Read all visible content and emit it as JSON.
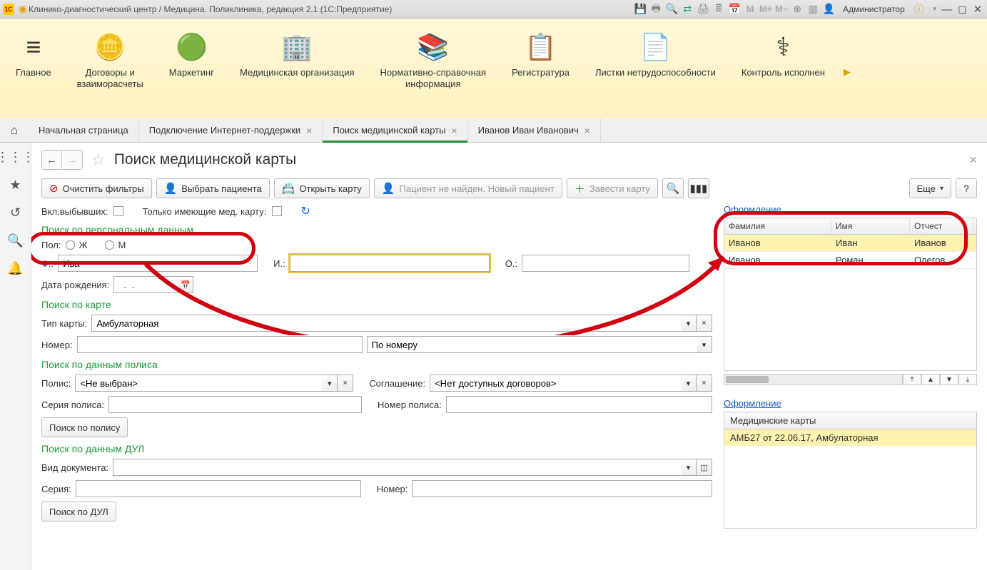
{
  "titlebar": {
    "title": "Клинико-диагностический центр / Медицина. Поликлиника, редакция 2.1  (1С:Предприятие)",
    "admin": "Администратор"
  },
  "ribbon": {
    "items": [
      {
        "label": "Главное"
      },
      {
        "label": "Договоры и\nвзаиморасчеты"
      },
      {
        "label": "Маркетинг"
      },
      {
        "label": "Медицинская организация"
      },
      {
        "label": "Нормативно-справочная\nинформация"
      },
      {
        "label": "Регистратура"
      },
      {
        "label": "Листки нетрудоспособности"
      },
      {
        "label": "Контроль исполнен"
      }
    ]
  },
  "tabs": {
    "start": "Начальная страница",
    "items": [
      {
        "label": "Подключение Интернет-поддержки"
      },
      {
        "label": "Поиск медицинской карты",
        "active": true
      },
      {
        "label": "Иванов Иван Иванович"
      }
    ]
  },
  "page": {
    "title": "Поиск медицинской карты"
  },
  "toolbar": {
    "clear": "Очистить фильтры",
    "select_patient": "Выбрать пациента",
    "open_card": "Открыть карту",
    "not_found": "Пациент не найден. Новый пациент",
    "new_card": "Завести карту",
    "more": "Еще",
    "help": "?"
  },
  "filters": {
    "incl_left": "Вкл.выбывших:",
    "has_card": "Только имеющие мед. карту:"
  },
  "personal": {
    "heading": "Поиск по персональным данным",
    "gender": "Пол:",
    "female": "Ж",
    "male": "М",
    "f": "Ф.:",
    "f_val": "Ива",
    "i": "И.:",
    "o": "О.:",
    "dob": "Дата рождения:",
    "dob_val": "  .  .    "
  },
  "card": {
    "heading": "Поиск по  карте",
    "type": "Тип карты:",
    "type_val": "Амбулаторная",
    "number": "Номер:",
    "by_number": "По номеру"
  },
  "policy": {
    "heading": "Поиск по данным полиса",
    "policy": "Полис:",
    "policy_val": "<Не выбран>",
    "agreement": "Соглашение:",
    "agreement_val": "<Нет доступных договоров>",
    "series": "Серия полиса:",
    "number": "Номер полиса:",
    "search": "Поиск по полису"
  },
  "dul": {
    "heading": "Поиск по данным ДУЛ",
    "doc_type": "Вид документа:",
    "series": "Серия:",
    "number": "Номер:",
    "search": "Поиск по ДУЛ"
  },
  "results": {
    "link": "Оформление",
    "cols": {
      "c1": "Фамилия",
      "c2": "Имя",
      "c3": "Отчест"
    },
    "rows": [
      {
        "c1": "Иванов",
        "c2": "Иван",
        "c3": "Иванов"
      },
      {
        "c1": "Иванов",
        "c2": "Роман",
        "c3": "Олегов"
      }
    ],
    "cards_head": "Медицинские карты",
    "card1": "АМБ27 от 22.06.17, Амбулаторная"
  }
}
